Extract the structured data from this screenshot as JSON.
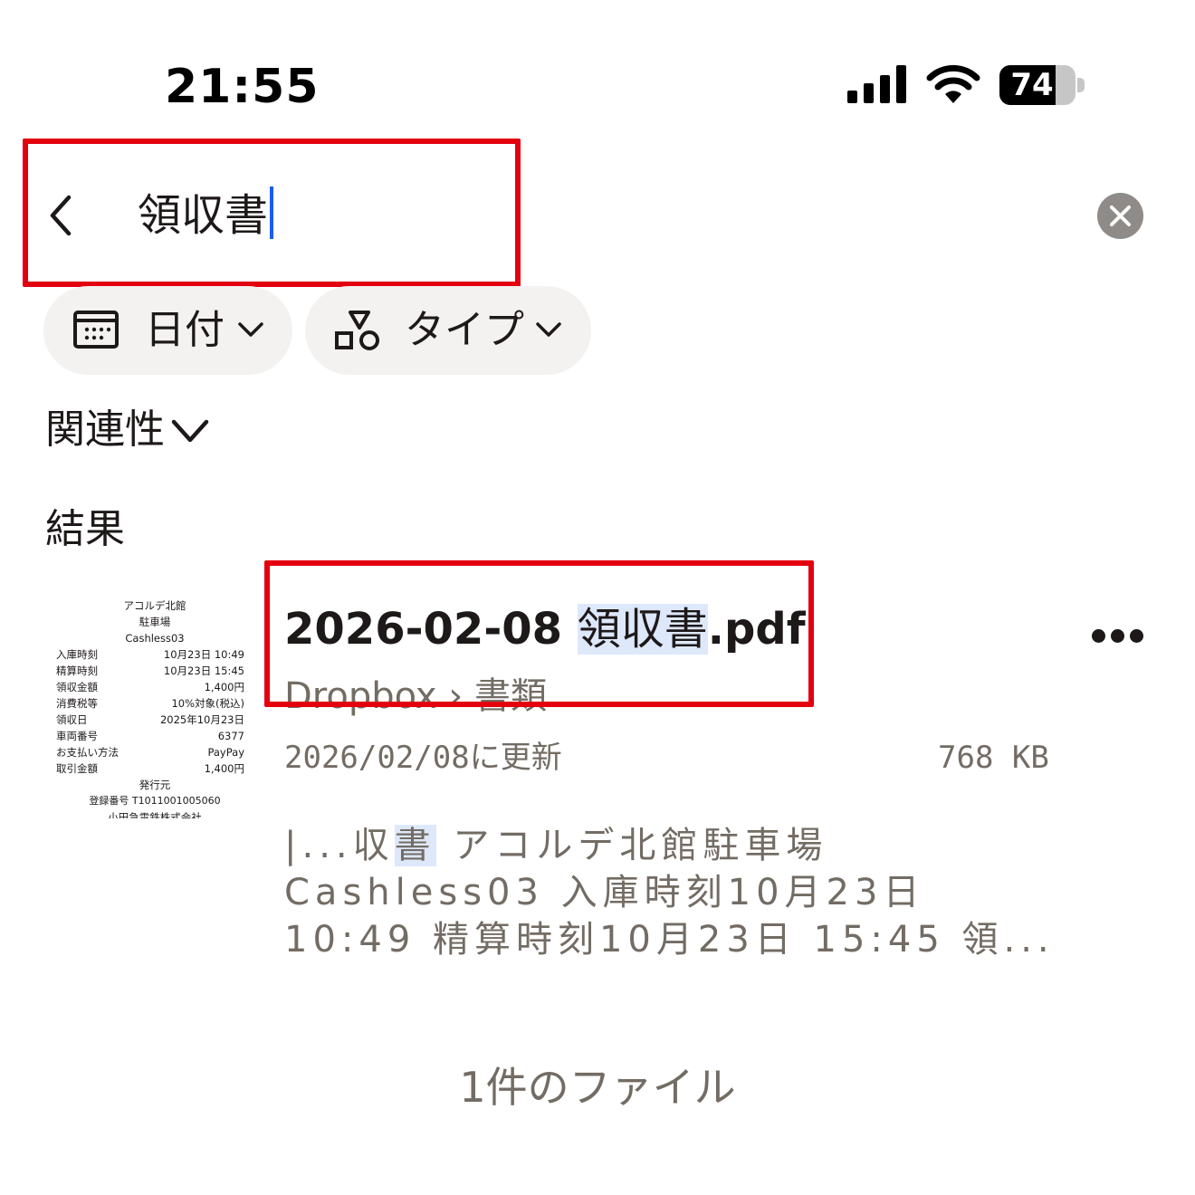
{
  "status_bar": {
    "time": "21:55",
    "battery_level": "74",
    "battery_fraction": 0.74,
    "signal_icon": "cellular-signal-icon",
    "wifi_icon": "wifi-icon"
  },
  "search": {
    "query": "領収書",
    "back_icon": "chevron-left-icon",
    "clear_icon": "clear-icon"
  },
  "filters": {
    "date_label": "日付",
    "date_icon": "calendar-icon",
    "type_label": "タイプ",
    "type_icon": "shapes-icon"
  },
  "sort": {
    "label": "関連性"
  },
  "results": {
    "heading": "結果",
    "items": [
      {
        "name_prefix": "2026-02-08 ",
        "name_match": "領収書",
        "name_suffix": ".pdf",
        "path": "Dropbox › 書類",
        "updated": "2026/02/08に更新",
        "size": "768 KB",
        "snippet_pre": "|...収",
        "snippet_match": "書",
        "snippet_post": "アコルデ北館駐車場 Cashless03 入庫時刻10月23日 10:49 精算時刻10月23日 15:45 領...",
        "thumbnail": {
          "title1": "アコルデ北館",
          "title2": "駐車場",
          "title3": "Cashless03",
          "rows": [
            [
              "入庫時刻",
              "10月23日 10:49"
            ],
            [
              "精算時刻",
              "10月23日 15:45"
            ],
            [
              "領収金額",
              "1,400円"
            ],
            [
              "消費税等",
              "10%対象(税込)"
            ],
            [
              "領収日",
              "2025年10月23日"
            ],
            [
              "車両番号",
              "6377"
            ],
            [
              "お支払い方法",
              "PayPay"
            ],
            [
              "取引金額",
              "1,400円"
            ]
          ],
          "issuer": "発行元",
          "reg": "登録番号 T1011001005060",
          "company": "小田急電鉄株式会社"
        }
      }
    ]
  },
  "footer": {
    "count_text": "1件のファイル"
  },
  "colors": {
    "highlight_box": "#e3000f",
    "match_bg": "#dde8fb",
    "caret": "#1a5df5",
    "secondary_text": "#736c64"
  }
}
